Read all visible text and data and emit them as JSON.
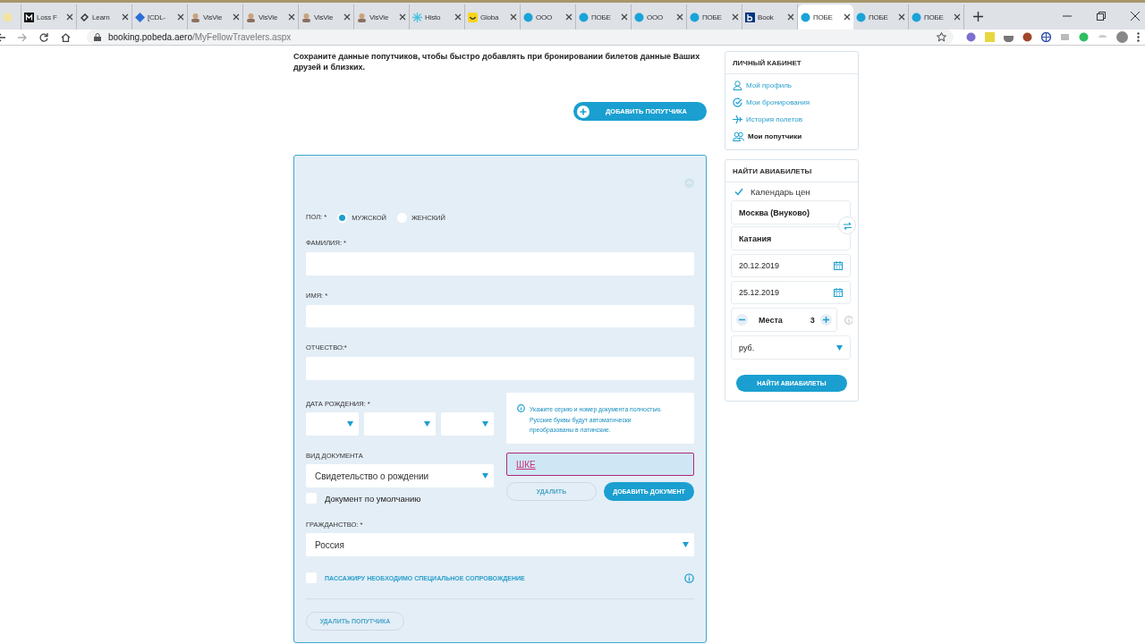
{
  "browser": {
    "tabs": [
      {
        "selected": false
      },
      {
        "title": "Loss F",
        "selected": false
      },
      {
        "title": "Learn",
        "selected": false
      },
      {
        "title": "[CDL-",
        "selected": false
      },
      {
        "title": "VisVie",
        "selected": false
      },
      {
        "title": "VisVie",
        "selected": false
      },
      {
        "title": "VisVie",
        "selected": false
      },
      {
        "title": "VisVie",
        "selected": false
      },
      {
        "title": "Histo",
        "selected": false
      },
      {
        "title": "Globa",
        "selected": false
      },
      {
        "title": "ООО",
        "selected": false
      },
      {
        "title": "ПОБЕ",
        "selected": false
      },
      {
        "title": "ООО",
        "selected": false
      },
      {
        "title": "ПОБЕ",
        "selected": false
      },
      {
        "title": "Book",
        "selected": false
      },
      {
        "title": "ПОБЕ",
        "selected": true
      },
      {
        "title": "ПОБЕ",
        "selected": false
      },
      {
        "title": "ПОБЕ",
        "selected": false
      }
    ],
    "url": {
      "host": "booking.pobeda.aero",
      "path": "/MyFellowTravelers.aspx"
    }
  },
  "intro": "Сохраните данные попутчиков, чтобы быстро добавлять при бронировании билетов данные Ваших друзей и близких.",
  "add_traveler_button": "ДОБАВИТЬ ПОПУТЧИКА",
  "form": {
    "sex": {
      "label": "ПОЛ: *",
      "options": [
        {
          "label": "МУЖСКОЙ",
          "selected": true
        },
        {
          "label": "ЖЕНСКИЙ",
          "selected": false
        }
      ]
    },
    "fields": [
      {
        "label": "ФАМИЛИЯ: *"
      },
      {
        "label": "ИМЯ: *"
      },
      {
        "label": "ОТЧЕСТВО:*"
      }
    ],
    "birth_date_label": "ДАТА РОЖДЕНИЯ: *",
    "doc_type": {
      "label": "ВИД ДОКУМЕНТА",
      "value": "Свидетельство о рождении"
    },
    "default_doc": {
      "label": "Документ по умолчанию",
      "checked": false
    },
    "tooltip": "Укажите серию и номер документа полностью. Русские буквы будут автоматически преобразованы в латинские.",
    "doc_number": "ШКЕ",
    "delete_doc_button": "УДАЛИТЬ",
    "add_doc_button": "ДОБАВИТЬ ДОКУМЕНТ",
    "citizenship": {
      "label": "ГРАЖДАНСТВО: *",
      "value": "Россия"
    },
    "escort": {
      "label": "ПАССАЖИРУ НЕОБХОДИМО СПЕЦИАЛЬНОЕ СОПРОВОЖДЕНИЕ",
      "checked": false
    },
    "delete_traveler_button": "УДАЛИТЬ ПОПУТЧИКА"
  },
  "cabinet": {
    "title": "ЛИЧНЫЙ КАБИНЕТ",
    "items": [
      {
        "label": "Мой профиль",
        "selected": false
      },
      {
        "label": "Мои бронирования",
        "selected": false
      },
      {
        "label": "История полетов",
        "selected": false
      },
      {
        "label": "Мои попутчики",
        "selected": true
      }
    ]
  },
  "search": {
    "title": "НАЙТИ АВИАБИЛЕТЫ",
    "calendar": {
      "label": "Календарь цен",
      "checked": true
    },
    "from": "Москва (Внуково)",
    "to": "Катания",
    "dates": [
      "20.12.2019",
      "25.12.2019"
    ],
    "seats_label": "Места",
    "seats": "3",
    "currency": "руб.",
    "button": "НАЙТИ АВИАБИЛЕТЫ"
  }
}
